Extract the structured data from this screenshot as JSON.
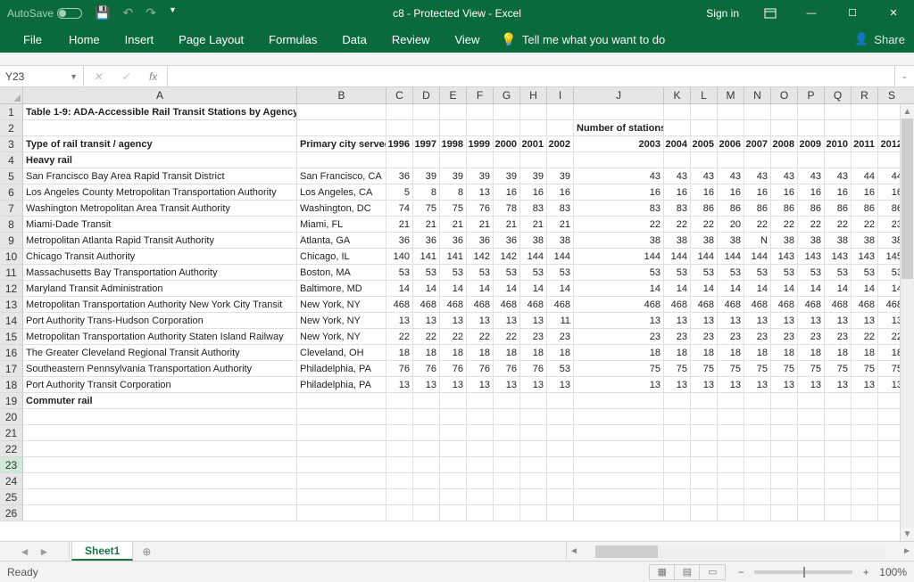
{
  "titlebar": {
    "autosave_label": "AutoSave",
    "title": "c8  -  Protected View  -  Excel",
    "signin": "Sign in"
  },
  "ribbon": {
    "file": "File",
    "tabs": [
      "Home",
      "Insert",
      "Page Layout",
      "Formulas",
      "Data",
      "Review",
      "View"
    ],
    "tell_placeholder": "Tell me what you want to do",
    "share": "Share"
  },
  "fbar": {
    "namebox": "Y23",
    "fx": "fx"
  },
  "columns": [
    "A",
    "B",
    "C",
    "D",
    "E",
    "F",
    "G",
    "H",
    "I",
    "J",
    "K",
    "L",
    "M",
    "N",
    "O",
    "P",
    "Q",
    "R",
    "S"
  ],
  "header_numstations": "Number of stations",
  "years": [
    "1996",
    "1997",
    "1998",
    "1999",
    "2000",
    "2001",
    "2002",
    "2003",
    "2004",
    "2005",
    "2006",
    "2007",
    "2008",
    "2009",
    "2010",
    "2011",
    "2012"
  ],
  "labels": {
    "title": "Table 1-9:  ADA-Accessible Rail Transit Stations by Agency",
    "type_header": "Type of rail transit / agency",
    "primary_city": "Primary city served",
    "heavy_rail": "Heavy rail",
    "commuter_rail": "Commuter rail"
  },
  "rows": [
    {
      "agency": "San Francisco Bay Area Rapid Transit District",
      "city": "San Francisco, CA",
      "v": [
        36,
        39,
        39,
        39,
        39,
        39,
        39,
        43,
        43,
        43,
        43,
        43,
        43,
        43,
        43,
        44,
        44
      ]
    },
    {
      "agency": "Los Angeles County Metropolitan Transportation Authority",
      "city": "Los Angeles, CA",
      "v": [
        5,
        8,
        8,
        13,
        16,
        16,
        16,
        16,
        16,
        16,
        16,
        16,
        16,
        16,
        16,
        16,
        16
      ]
    },
    {
      "agency": "Washington Metropolitan Area Transit Authority",
      "city": "Washington, DC",
      "v": [
        74,
        75,
        75,
        76,
        78,
        83,
        83,
        83,
        83,
        86,
        86,
        86,
        86,
        86,
        86,
        86,
        86
      ]
    },
    {
      "agency": "Miami-Dade Transit",
      "city": "Miami, FL",
      "v": [
        21,
        21,
        21,
        21,
        21,
        21,
        21,
        22,
        22,
        22,
        20,
        22,
        22,
        22,
        22,
        22,
        23
      ]
    },
    {
      "agency": "Metropolitan Atlanta Rapid Transit Authority",
      "city": "Atlanta, GA",
      "v": [
        36,
        36,
        36,
        36,
        36,
        38,
        38,
        38,
        38,
        38,
        38,
        "N",
        38,
        38,
        38,
        38,
        38
      ]
    },
    {
      "agency": "Chicago Transit Authority",
      "city": "Chicago, IL",
      "v": [
        140,
        141,
        141,
        142,
        142,
        144,
        144,
        144,
        144,
        144,
        144,
        144,
        143,
        143,
        143,
        143,
        145
      ]
    },
    {
      "agency": "Massachusetts Bay Transportation Authority",
      "city": "Boston, MA",
      "v": [
        53,
        53,
        53,
        53,
        53,
        53,
        53,
        53,
        53,
        53,
        53,
        53,
        53,
        53,
        53,
        53,
        53
      ]
    },
    {
      "agency": "Maryland Transit Administration",
      "city": "Baltimore, MD",
      "v": [
        14,
        14,
        14,
        14,
        14,
        14,
        14,
        14,
        14,
        14,
        14,
        14,
        14,
        14,
        14,
        14,
        14
      ]
    },
    {
      "agency": "Metropolitan Transportation Authority New York City Transit",
      "city": "New York, NY",
      "v": [
        468,
        468,
        468,
        468,
        468,
        468,
        468,
        468,
        468,
        468,
        468,
        468,
        468,
        468,
        468,
        468,
        468
      ]
    },
    {
      "agency": "Port Authority Trans-Hudson Corporation",
      "city": "New York, NY",
      "v": [
        13,
        13,
        13,
        13,
        13,
        13,
        11,
        13,
        13,
        13,
        13,
        13,
        13,
        13,
        13,
        13,
        13
      ]
    },
    {
      "agency": "Metropolitan Transportation Authority Staten Island Railway",
      "city": "New York, NY",
      "v": [
        22,
        22,
        22,
        22,
        22,
        23,
        23,
        23,
        23,
        23,
        23,
        23,
        23,
        23,
        23,
        22,
        22
      ]
    },
    {
      "agency": "The Greater Cleveland Regional Transit Authority",
      "city": "Cleveland, OH",
      "v": [
        18,
        18,
        18,
        18,
        18,
        18,
        18,
        18,
        18,
        18,
        18,
        18,
        18,
        18,
        18,
        18,
        18
      ]
    },
    {
      "agency": "Southeastern Pennsylvania Transportation Authority",
      "city": "Philadelphia, PA",
      "v": [
        76,
        76,
        76,
        76,
        76,
        76,
        53,
        75,
        75,
        75,
        75,
        75,
        75,
        75,
        75,
        75,
        75
      ]
    },
    {
      "agency": "Port Authority Transit Corporation",
      "city": "Philadelphia, PA",
      "v": [
        13,
        13,
        13,
        13,
        13,
        13,
        13,
        13,
        13,
        13,
        13,
        13,
        13,
        13,
        13,
        13,
        13
      ]
    }
  ],
  "sheet": {
    "name": "Sheet1"
  },
  "status": {
    "ready": "Ready",
    "zoom": "100%"
  },
  "selected_row": 23
}
